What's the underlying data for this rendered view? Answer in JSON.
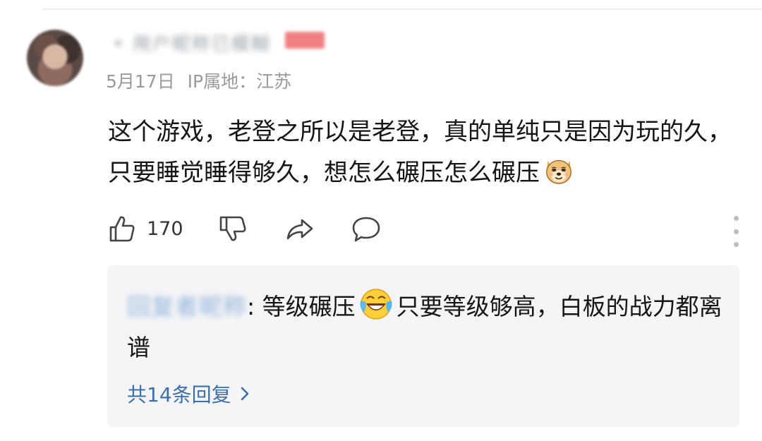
{
  "comment": {
    "author_name": "• 用户昵称已模糊",
    "date": "5月17日",
    "ip_location": "IP属地：江苏",
    "text": "这个游戏，老登之所以是老登，真的单纯只是因为玩的久，只要睡觉睡得够久，想怎么碾压怎么碾压",
    "trailing_emoji": "doge-emoji",
    "like_count": "170",
    "icons": [
      "thumbs-up-icon",
      "thumbs-down-icon",
      "share-icon",
      "comment-icon",
      "more-vertical-icon"
    ]
  },
  "reply": {
    "author_name": "回复者昵称",
    "separator": ": ",
    "text_part1": "等级碾压",
    "emoji": "laughing-crying-emoji",
    "text_part2": "只要等级够高，白板的战力都离谱",
    "more_replies_label": "共14条回复",
    "link_color": "#3d6fa8"
  },
  "colors": {
    "background": "#ffffff",
    "reply_background": "#f5f5f7",
    "meta_text": "#9a9a9a",
    "badge": "#f08080"
  }
}
